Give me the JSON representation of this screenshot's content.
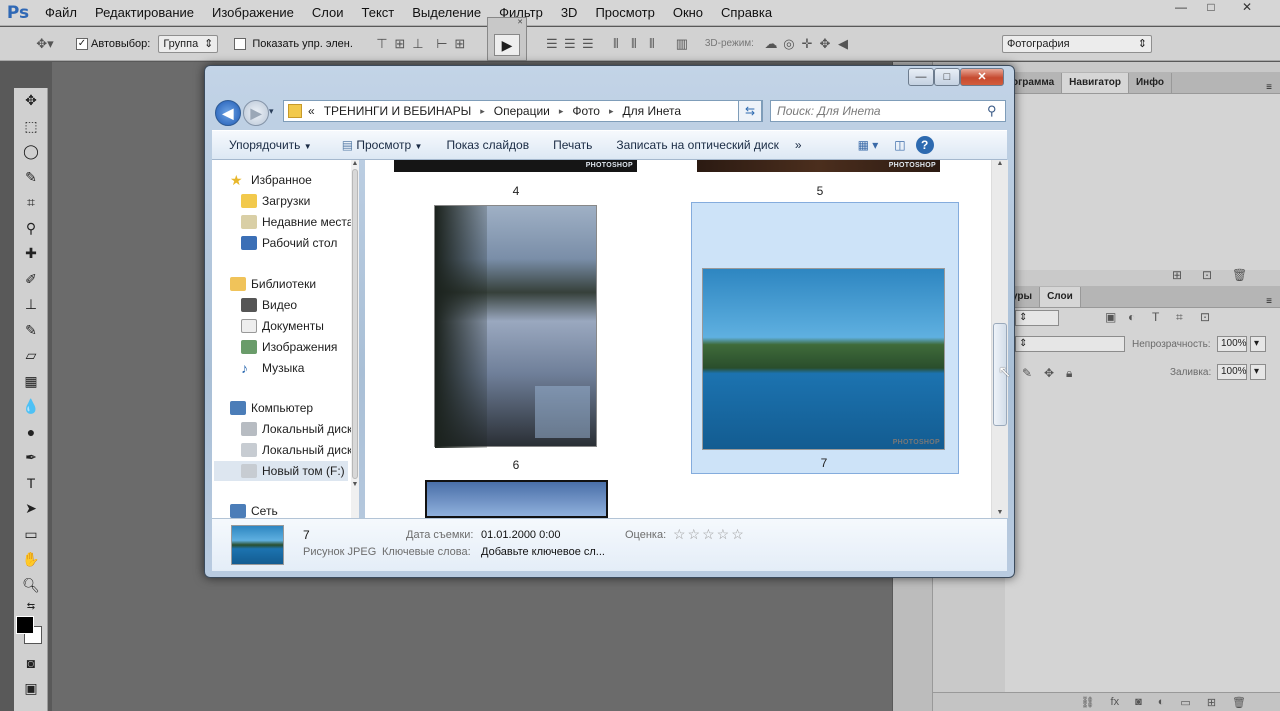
{
  "app": {
    "logo": "Ps"
  },
  "menubar": {
    "items": [
      "Файл",
      "Редактирование",
      "Изображение",
      "Слои",
      "Текст",
      "Выделение",
      "Фильтр",
      "3D",
      "Просмотр",
      "Окно",
      "Справка"
    ],
    "window_controls": [
      "—",
      "□",
      "✕"
    ]
  },
  "options_bar": {
    "autoselect_label": "Автовыбор:",
    "autoselect_checked": true,
    "autoselect_value": "Группа",
    "show_controls_label": "Показать упр. элен.",
    "mode_3d_label": "3D-режим:",
    "workspace_value": "Фотография"
  },
  "panels": {
    "top_tabs": [
      "ограмма",
      "Навигатор",
      "Инфо"
    ],
    "layers_tabs": [
      "уры",
      "Слои"
    ],
    "opacity_label": "Непрозрачность:",
    "opacity_value": "100%",
    "fill_label": "Заливка:",
    "fill_value": "100%"
  },
  "dialog": {
    "breadcrumb": [
      "«",
      "ТРЕНИНГИ И ВЕБИНАРЫ",
      "▸",
      "Операции",
      "▸",
      "Фото",
      "▸",
      "Для Инета"
    ],
    "search_placeholder": "Поиск: Для Инета",
    "toolbar": {
      "organize": "Упорядочить",
      "view": "Просмотр",
      "slideshow": "Показ слайдов",
      "print": "Печать",
      "burn": "Записать на оптический диск",
      "more": "»"
    },
    "nav": {
      "favorites": "Избранное",
      "downloads": "Загрузки",
      "recent": "Недавние места",
      "desktop": "Рабочий стол",
      "libraries": "Библиотеки",
      "video": "Видео",
      "documents": "Документы",
      "images": "Изображения",
      "music": "Музыка",
      "computer": "Компьютер",
      "local_c": "Локальный диск",
      "local_d": "Локальный диск",
      "new_volume": "Новый том (F:)",
      "network": "Сеть"
    },
    "thumbs": {
      "t4": "4",
      "t5": "5",
      "t6": "6",
      "t7": "7",
      "stamp": "PHOTOSHOP"
    },
    "details": {
      "name": "7",
      "type": "Рисунок JPEG",
      "date_label": "Дата съемки:",
      "date_value": "01.01.2000 0:00",
      "keywords_label": "Ключевые слова:",
      "keywords_value": "Добавьте ключевое сл...",
      "rating_label": "Оценка:",
      "rating_stars": "☆☆☆☆☆"
    }
  },
  "colors": {
    "selection": "#cde3f8",
    "selection_border": "#84acdd",
    "ps_blue": "#2f68b5"
  }
}
